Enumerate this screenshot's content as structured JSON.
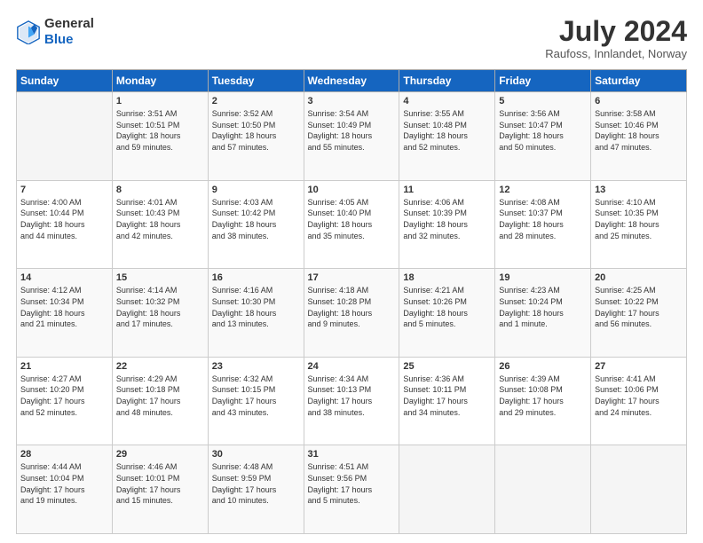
{
  "header": {
    "logo_line1": "General",
    "logo_line2": "Blue",
    "month_title": "July 2024",
    "location": "Raufoss, Innlandet, Norway"
  },
  "days_of_week": [
    "Sunday",
    "Monday",
    "Tuesday",
    "Wednesday",
    "Thursday",
    "Friday",
    "Saturday"
  ],
  "weeks": [
    [
      {
        "day": "",
        "info": ""
      },
      {
        "day": "1",
        "info": "Sunrise: 3:51 AM\nSunset: 10:51 PM\nDaylight: 18 hours\nand 59 minutes."
      },
      {
        "day": "2",
        "info": "Sunrise: 3:52 AM\nSunset: 10:50 PM\nDaylight: 18 hours\nand 57 minutes."
      },
      {
        "day": "3",
        "info": "Sunrise: 3:54 AM\nSunset: 10:49 PM\nDaylight: 18 hours\nand 55 minutes."
      },
      {
        "day": "4",
        "info": "Sunrise: 3:55 AM\nSunset: 10:48 PM\nDaylight: 18 hours\nand 52 minutes."
      },
      {
        "day": "5",
        "info": "Sunrise: 3:56 AM\nSunset: 10:47 PM\nDaylight: 18 hours\nand 50 minutes."
      },
      {
        "day": "6",
        "info": "Sunrise: 3:58 AM\nSunset: 10:46 PM\nDaylight: 18 hours\nand 47 minutes."
      }
    ],
    [
      {
        "day": "7",
        "info": "Sunrise: 4:00 AM\nSunset: 10:44 PM\nDaylight: 18 hours\nand 44 minutes."
      },
      {
        "day": "8",
        "info": "Sunrise: 4:01 AM\nSunset: 10:43 PM\nDaylight: 18 hours\nand 42 minutes."
      },
      {
        "day": "9",
        "info": "Sunrise: 4:03 AM\nSunset: 10:42 PM\nDaylight: 18 hours\nand 38 minutes."
      },
      {
        "day": "10",
        "info": "Sunrise: 4:05 AM\nSunset: 10:40 PM\nDaylight: 18 hours\nand 35 minutes."
      },
      {
        "day": "11",
        "info": "Sunrise: 4:06 AM\nSunset: 10:39 PM\nDaylight: 18 hours\nand 32 minutes."
      },
      {
        "day": "12",
        "info": "Sunrise: 4:08 AM\nSunset: 10:37 PM\nDaylight: 18 hours\nand 28 minutes."
      },
      {
        "day": "13",
        "info": "Sunrise: 4:10 AM\nSunset: 10:35 PM\nDaylight: 18 hours\nand 25 minutes."
      }
    ],
    [
      {
        "day": "14",
        "info": "Sunrise: 4:12 AM\nSunset: 10:34 PM\nDaylight: 18 hours\nand 21 minutes."
      },
      {
        "day": "15",
        "info": "Sunrise: 4:14 AM\nSunset: 10:32 PM\nDaylight: 18 hours\nand 17 minutes."
      },
      {
        "day": "16",
        "info": "Sunrise: 4:16 AM\nSunset: 10:30 PM\nDaylight: 18 hours\nand 13 minutes."
      },
      {
        "day": "17",
        "info": "Sunrise: 4:18 AM\nSunset: 10:28 PM\nDaylight: 18 hours\nand 9 minutes."
      },
      {
        "day": "18",
        "info": "Sunrise: 4:21 AM\nSunset: 10:26 PM\nDaylight: 18 hours\nand 5 minutes."
      },
      {
        "day": "19",
        "info": "Sunrise: 4:23 AM\nSunset: 10:24 PM\nDaylight: 18 hours\nand 1 minute."
      },
      {
        "day": "20",
        "info": "Sunrise: 4:25 AM\nSunset: 10:22 PM\nDaylight: 17 hours\nand 56 minutes."
      }
    ],
    [
      {
        "day": "21",
        "info": "Sunrise: 4:27 AM\nSunset: 10:20 PM\nDaylight: 17 hours\nand 52 minutes."
      },
      {
        "day": "22",
        "info": "Sunrise: 4:29 AM\nSunset: 10:18 PM\nDaylight: 17 hours\nand 48 minutes."
      },
      {
        "day": "23",
        "info": "Sunrise: 4:32 AM\nSunset: 10:15 PM\nDaylight: 17 hours\nand 43 minutes."
      },
      {
        "day": "24",
        "info": "Sunrise: 4:34 AM\nSunset: 10:13 PM\nDaylight: 17 hours\nand 38 minutes."
      },
      {
        "day": "25",
        "info": "Sunrise: 4:36 AM\nSunset: 10:11 PM\nDaylight: 17 hours\nand 34 minutes."
      },
      {
        "day": "26",
        "info": "Sunrise: 4:39 AM\nSunset: 10:08 PM\nDaylight: 17 hours\nand 29 minutes."
      },
      {
        "day": "27",
        "info": "Sunrise: 4:41 AM\nSunset: 10:06 PM\nDaylight: 17 hours\nand 24 minutes."
      }
    ],
    [
      {
        "day": "28",
        "info": "Sunrise: 4:44 AM\nSunset: 10:04 PM\nDaylight: 17 hours\nand 19 minutes."
      },
      {
        "day": "29",
        "info": "Sunrise: 4:46 AM\nSunset: 10:01 PM\nDaylight: 17 hours\nand 15 minutes."
      },
      {
        "day": "30",
        "info": "Sunrise: 4:48 AM\nSunset: 9:59 PM\nDaylight: 17 hours\nand 10 minutes."
      },
      {
        "day": "31",
        "info": "Sunrise: 4:51 AM\nSunset: 9:56 PM\nDaylight: 17 hours\nand 5 minutes."
      },
      {
        "day": "",
        "info": ""
      },
      {
        "day": "",
        "info": ""
      },
      {
        "day": "",
        "info": ""
      }
    ]
  ]
}
